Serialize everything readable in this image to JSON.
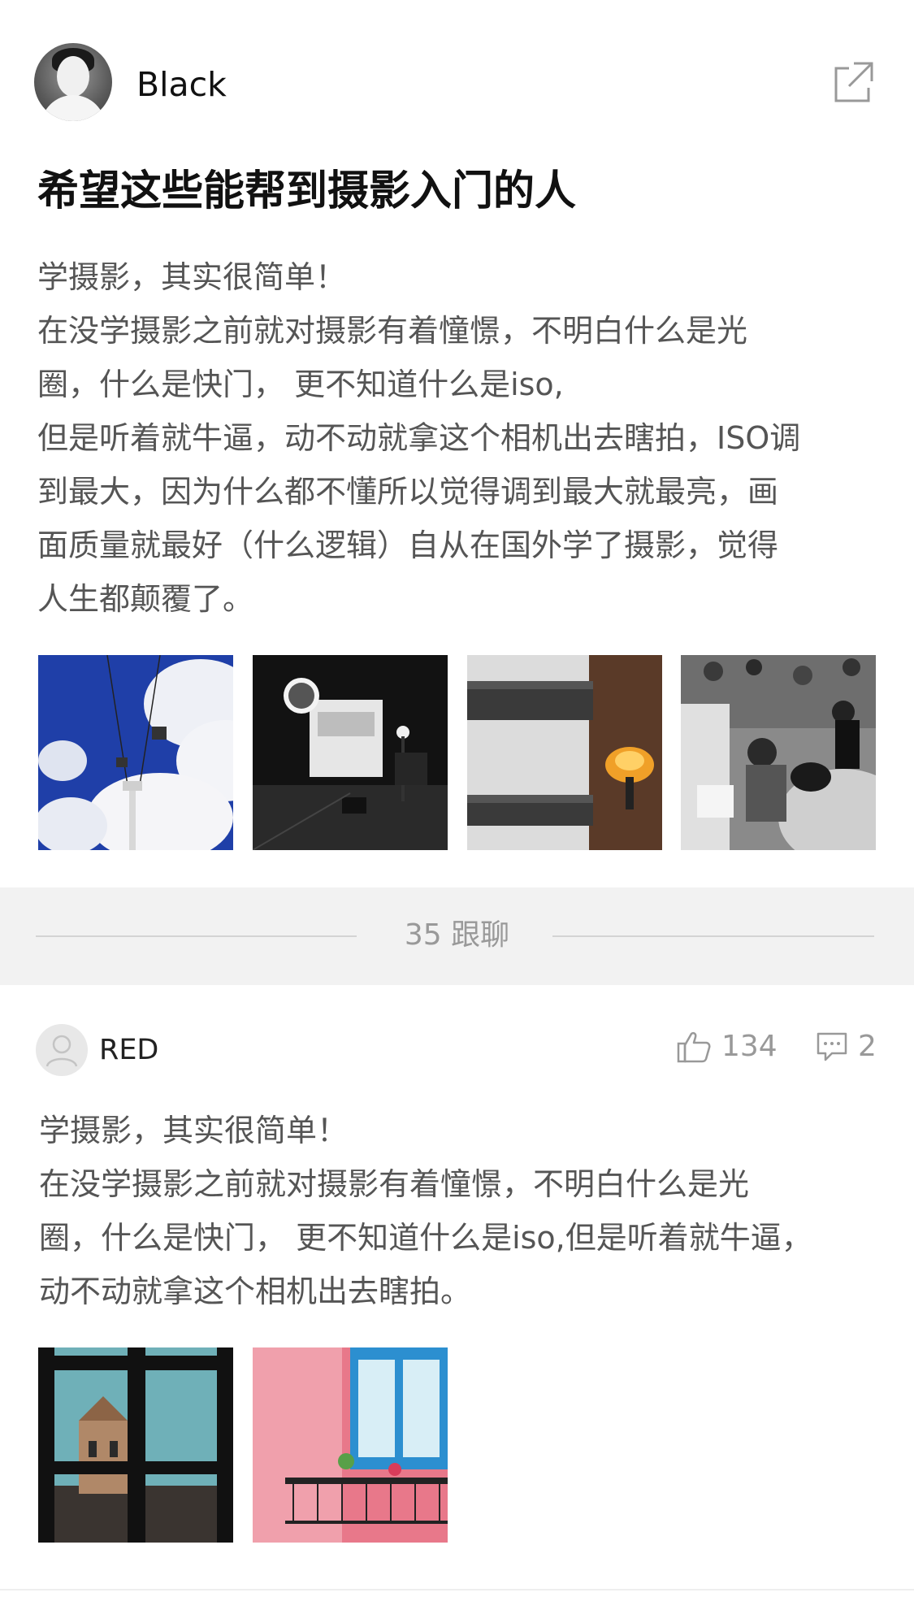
{
  "post": {
    "author": "Black",
    "title": "希望这些能帮到摄影入门的人",
    "body_lines": [
      "学摄影，其实很简单！",
      "在没学摄影之前就对摄影有着憧憬，不明白什么是光",
      "圈，什么是快门， 更不知道什么是iso,",
      "但是听着就牛逼，动不动就拿这个相机出去瞎拍，ISO调",
      "到最大，因为什么都不懂所以觉得调到最大就最亮，画",
      "面质量就最好（什么逻辑）自从在国外学了摄影，觉得",
      "人生都颠覆了。"
    ],
    "images": [
      "cable-car-sky-photo",
      "night-street-photo",
      "bridge-lamp-photo",
      "crowd-fountain-photo"
    ]
  },
  "divider": {
    "label": "35 跟聊"
  },
  "reply": {
    "author": "RED",
    "likes": "134",
    "comments": "2",
    "body_lines": [
      "学摄影，其实很简单！",
      "在没学摄影之前就对摄影有着憧憬，不明白什么是光",
      "圈，什么是快门， 更不知道什么是iso,但是听着就牛逼，",
      "动不动就拿这个相机出去瞎拍。"
    ],
    "images": [
      "window-tower-photo",
      "pink-balcony-photo"
    ]
  },
  "icons": {
    "share": "share-icon",
    "like": "thumbs-up-icon",
    "comment": "comment-icon",
    "avatar_placeholder": "user-icon"
  },
  "colors": {
    "divider_bg": "#f2f2f2",
    "muted_text": "#999999",
    "body_text": "#555555"
  }
}
